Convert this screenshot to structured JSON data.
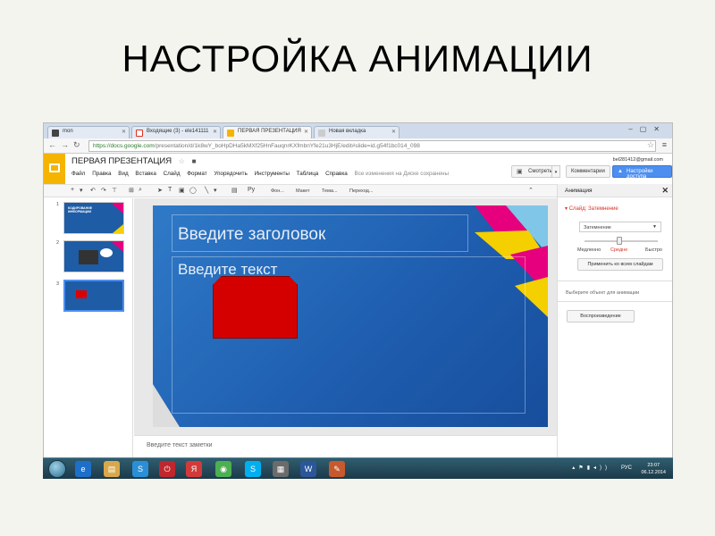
{
  "heading": "НАСТРОЙКА АНИМАЦИИ",
  "browser": {
    "tabs": [
      {
        "label": "mon",
        "icon": "page-icon",
        "color": "#444"
      },
      {
        "label": "Входящие (3) - ele141111",
        "icon": "gmail-icon",
        "color": "#d93025"
      },
      {
        "label": "ПЕРВАЯ ПРЕЗЕНТАЦИЯ",
        "icon": "slides-icon",
        "color": "#f4b400"
      },
      {
        "label": "Новая вкладка",
        "icon": "newtab-icon",
        "color": "#ccc"
      }
    ],
    "url_host": "https://docs.google.com",
    "url_path": "/presentation/d/1k8wY_boHpDHa5kMXf25HnFauqnrKXfmbnYfe21u3HjE/edit#slide=id.g54f1bc014_098"
  },
  "docs": {
    "title": "ПЕРВАЯ ПРЕЗЕНТАЦИЯ",
    "menu": [
      "Файл",
      "Правка",
      "Вид",
      "Вставка",
      "Слайд",
      "Формат",
      "Упорядочить",
      "Инструменты",
      "Таблица",
      "Справка"
    ],
    "saved_status": "Все изменения на Диске сохранены",
    "show_label": "Смотреть",
    "comments_label": "Комментарии",
    "share_label": "Настройки доступа",
    "email": "bel281412@gmail.com"
  },
  "toolbar": {
    "font": "Фон...",
    "layout": "Макет",
    "theme": "Тема...",
    "transition": "Переход..."
  },
  "filmstrip": {
    "numbers": [
      "1",
      "2",
      "3"
    ],
    "slide1_text": "КОДИРОВАНИЕ ИНФОРМАЦИИ"
  },
  "slide": {
    "title_placeholder": "Введите заголовок",
    "body_placeholder": "Введите текст"
  },
  "notes": {
    "placeholder": "Введите текст заметки"
  },
  "panel": {
    "title": "Анимация",
    "transition_label": "Слайд: Затемнение",
    "effect": "Затемнение",
    "speed_slow": "Медленно",
    "speed_mid": "Средне",
    "speed_fast": "Быстро",
    "apply_all": "Применить ко всем слайдам",
    "choose_object": "Выберите объект для анимации",
    "play": "Воспроизведение"
  },
  "taskbar": {
    "lang": "РУС",
    "time": "23:07",
    "date": "06.12.2014",
    "apps": [
      {
        "name": "ie-icon",
        "glyph": "e",
        "color": "#1e6fc9"
      },
      {
        "name": "explorer-icon",
        "glyph": "▤",
        "color": "#d8a84a"
      },
      {
        "name": "skype-tray-icon",
        "glyph": "S",
        "color": "#2a8fd6"
      },
      {
        "name": "power-icon",
        "glyph": "⏻",
        "color": "#c0272d"
      },
      {
        "name": "yandex-icon",
        "glyph": "Я",
        "color": "#d23a3a"
      },
      {
        "name": "chrome-icon",
        "glyph": "◉",
        "color": "#4caf50"
      },
      {
        "name": "skype-icon",
        "glyph": "S",
        "color": "#00aff0"
      },
      {
        "name": "calculator-icon",
        "glyph": "▦",
        "color": "#6b6b6b"
      },
      {
        "name": "word-icon",
        "glyph": "W",
        "color": "#2b579a"
      },
      {
        "name": "paint-icon",
        "glyph": "✎",
        "color": "#c65a2e"
      }
    ]
  }
}
